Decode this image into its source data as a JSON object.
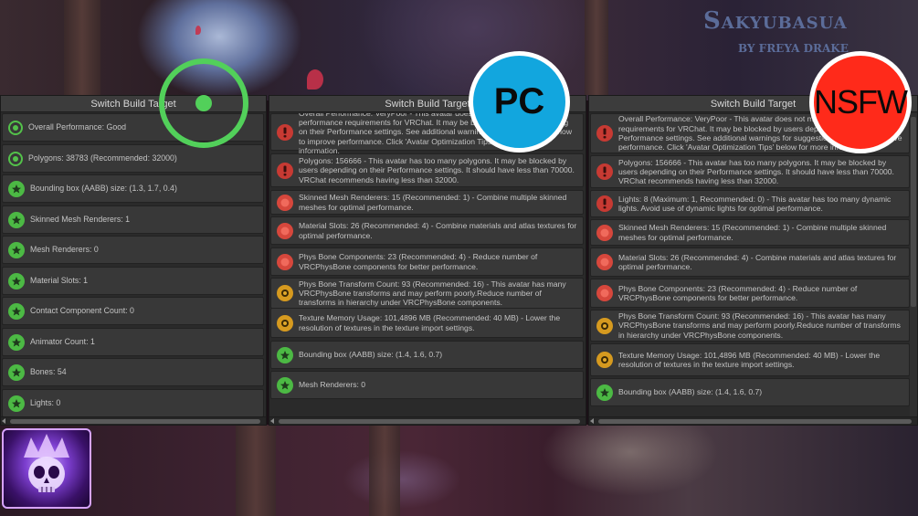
{
  "logo": {
    "title": "Sakyubasua",
    "subtitle": "BY FREYA DRAKE"
  },
  "overlays": {
    "pc_label": "PC",
    "nsfw_label": "NSFW"
  },
  "panels": [
    {
      "header": "Switch Build Target",
      "rows": [
        {
          "icon": "good",
          "text": "Overall Performance: Good"
        },
        {
          "icon": "good",
          "text": "Polygons: 38783 (Recommended: 32000)"
        },
        {
          "icon": "excellent",
          "text": "Bounding box (AABB) size: (1.3, 1.7, 0.4)"
        },
        {
          "icon": "excellent",
          "text": "Skinned Mesh Renderers: 1"
        },
        {
          "icon": "excellent",
          "text": "Mesh Renderers: 0"
        },
        {
          "icon": "excellent",
          "text": "Material Slots: 1"
        },
        {
          "icon": "excellent",
          "text": "Contact Component Count: 0"
        },
        {
          "icon": "excellent",
          "text": "Animator Count: 1"
        },
        {
          "icon": "excellent",
          "text": "Bones: 54"
        },
        {
          "icon": "excellent",
          "text": "Lights: 0"
        }
      ]
    },
    {
      "header": "Switch Build Target",
      "rows": [
        {
          "icon": "verypoor",
          "text": "Overall Performance: VeryPoor - This avatar does not meet minimum performance requirements for VRChat. It may be blocked by users depending on their Performance settings. See additional warnings for suggestions on how to improve performance. Click 'Avatar Optimization Tips' below for more information."
        },
        {
          "icon": "verypoor",
          "text": "Polygons: 156666 - This avatar has too many polygons. It may be blocked by users depending on their Performance settings. It should have less than 70000. VRChat recommends having less than 32000."
        },
        {
          "icon": "poor",
          "text": "Skinned Mesh Renderers: 15 (Recommended: 1) - Combine multiple skinned meshes for optimal performance."
        },
        {
          "icon": "poor",
          "text": "Material Slots: 26 (Recommended: 4) - Combine materials and atlas textures for optimal performance."
        },
        {
          "icon": "poor",
          "text": "Phys Bone Components: 23 (Recommended: 4) - Reduce number of VRCPhysBone components for better performance."
        },
        {
          "icon": "medium",
          "text": "Phys Bone Transform Count: 93 (Recommended: 16) - This avatar has many VRCPhysBone transforms and may perform poorly.Reduce number of transforms in hierarchy under VRCPhysBone components."
        },
        {
          "icon": "medium",
          "text": "Texture Memory Usage: 101,4896 MB (Recommended: 40 MB) - Lower the resolution of textures in the texture import settings."
        },
        {
          "icon": "excellent",
          "text": "Bounding box (AABB) size: (1.4, 1.6, 0.7)"
        },
        {
          "icon": "excellent",
          "text": "Mesh Renderers: 0"
        }
      ]
    },
    {
      "header": "Switch Build Target",
      "rows": [
        {
          "icon": "verypoor",
          "text": "Overall Performance: VeryPoor - This avatar does not meet minimum performance requirements for VRChat. It may be blocked by users depending on their Performance settings. See additional warnings for suggestions on how to improve performance. Click 'Avatar Optimization Tips' below for more information."
        },
        {
          "icon": "verypoor",
          "text": "Polygons: 156666 - This avatar has too many polygons. It may be blocked by users depending on their Performance settings. It should have less than 70000. VRChat recommends having less than 32000."
        },
        {
          "icon": "verypoor",
          "text": "Lights: 8 (Maximum: 1, Recommended: 0) - This avatar has too many dynamic lights. Avoid use of dynamic lights for optimal performance."
        },
        {
          "icon": "poor",
          "text": "Skinned Mesh Renderers: 15 (Recommended: 1) - Combine multiple skinned meshes for optimal performance."
        },
        {
          "icon": "poor",
          "text": "Material Slots: 26 (Recommended: 4) - Combine materials and atlas textures for optimal performance."
        },
        {
          "icon": "poor",
          "text": "Phys Bone Components: 23 (Recommended: 4) - Reduce number of VRCPhysBone components for better performance."
        },
        {
          "icon": "medium",
          "text": "Phys Bone Transform Count: 93 (Recommended: 16) - This avatar has many VRCPhysBone transforms and may perform poorly.Reduce number of transforms in hierarchy under VRCPhysBone components."
        },
        {
          "icon": "medium",
          "text": "Texture Memory Usage: 101,4896 MB (Recommended: 40 MB) - Lower the resolution of textures in the texture import settings."
        },
        {
          "icon": "excellent",
          "text": "Bounding box (AABB) size: (1.4, 1.6, 0.7)"
        }
      ]
    }
  ],
  "colors": {
    "good": "#53c24a",
    "excellent": "#4cb944",
    "verypoor": "#c73a33",
    "poor": "#d6473c",
    "medium": "#d69a1f",
    "pc_badge": "#12a6de",
    "nsfw_badge": "#ff2a1a"
  }
}
